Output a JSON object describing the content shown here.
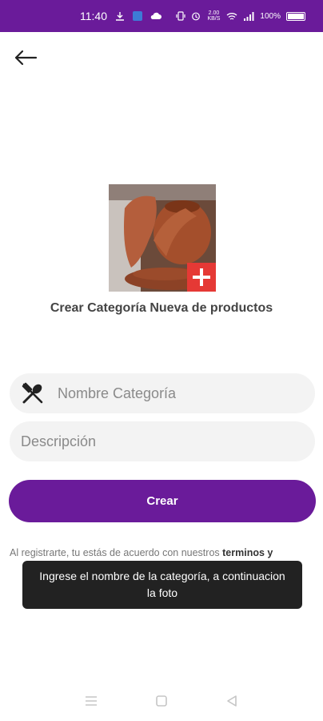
{
  "status_bar": {
    "time": "11:40",
    "data_speed": "2.00 KB/S",
    "battery_percent": "100%"
  },
  "header": {
    "back_icon": "arrow-left-icon"
  },
  "category": {
    "image_icon": "pottery-photo",
    "add_icon": "plus-icon",
    "title": "Crear Categoría Nueva de productos"
  },
  "form": {
    "name_placeholder": "Nombre Categoría",
    "name_value": "",
    "name_icon": "utensils-icon",
    "description_placeholder": "Descripción",
    "description_value": "",
    "create_label": "Crear"
  },
  "terms": {
    "text": "Al registrarte, tu estás de acuerdo con nuestros ",
    "link": "terminos y"
  },
  "toast": {
    "message": "Ingrese el nombre de la categoría, a continuacion la foto"
  },
  "colors": {
    "primary": "#6a1b9a",
    "badge": "#e53935",
    "input_bg": "#f3f3f3",
    "toast_bg": "#222222"
  }
}
